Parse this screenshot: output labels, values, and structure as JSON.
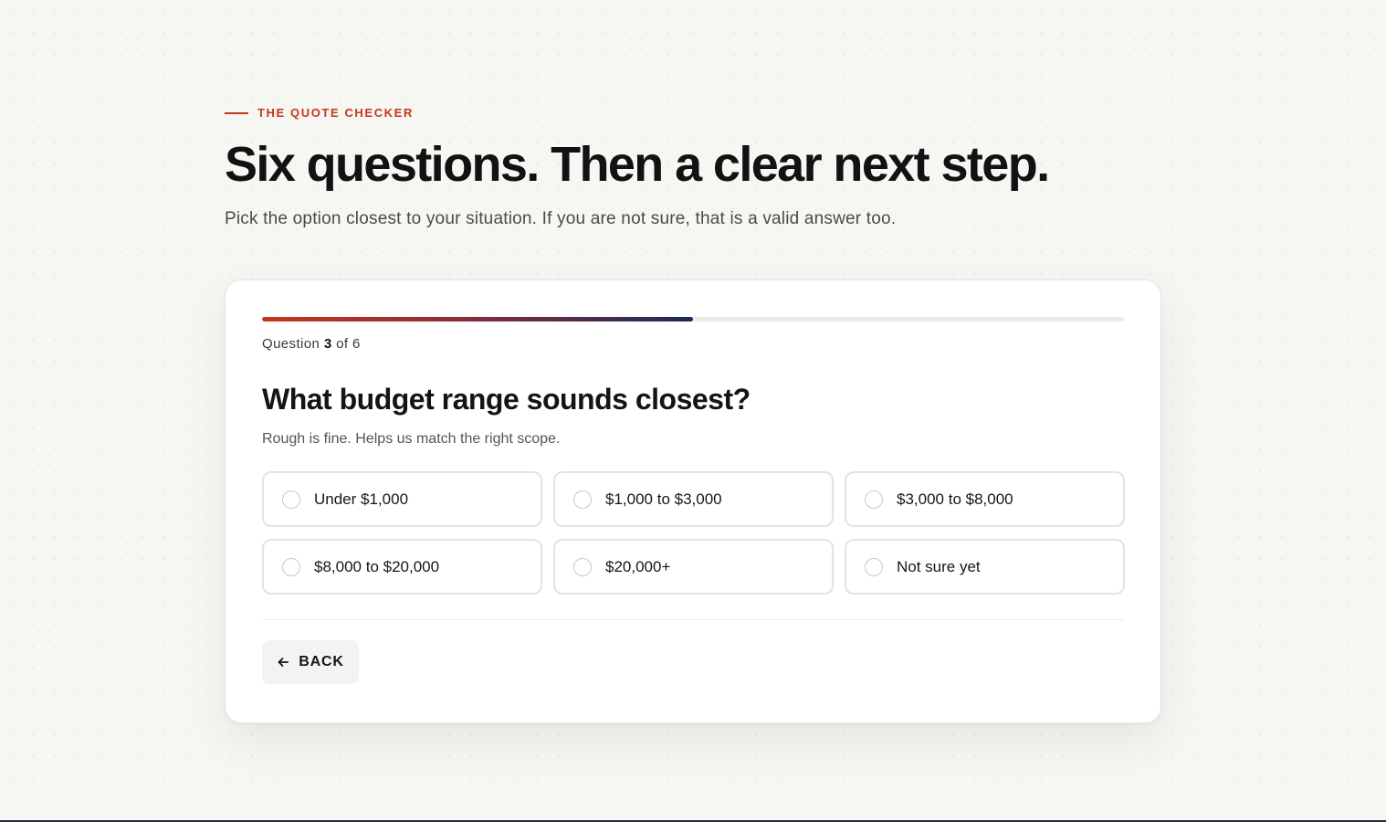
{
  "hero": {
    "eyebrow": "THE QUOTE CHECKER",
    "headline": "Six questions. Then a clear next step.",
    "subhead": "Pick the option closest to your situation. If you are not sure, that is a valid answer too."
  },
  "progress": {
    "fraction": 0.5,
    "label_prefix": "Question",
    "current": "3",
    "label_mid": "of",
    "total": "6"
  },
  "question": {
    "title": "What budget range sounds closest?",
    "hint": "Rough is fine. Helps us match the right scope.",
    "options": [
      {
        "label": "Under $1,000",
        "selected": false
      },
      {
        "label": "$1,000 to $3,000",
        "selected": false
      },
      {
        "label": "$3,000 to $8,000",
        "selected": false
      },
      {
        "label": "$8,000 to $20,000",
        "selected": false
      },
      {
        "label": "$20,000+",
        "selected": false
      },
      {
        "label": "Not sure yet",
        "selected": false
      }
    ]
  },
  "nav": {
    "back_label": "BACK",
    "back_icon": "arrow-left-icon"
  },
  "colors": {
    "accent": "#c8361e",
    "navy": "#1e2a5a"
  }
}
